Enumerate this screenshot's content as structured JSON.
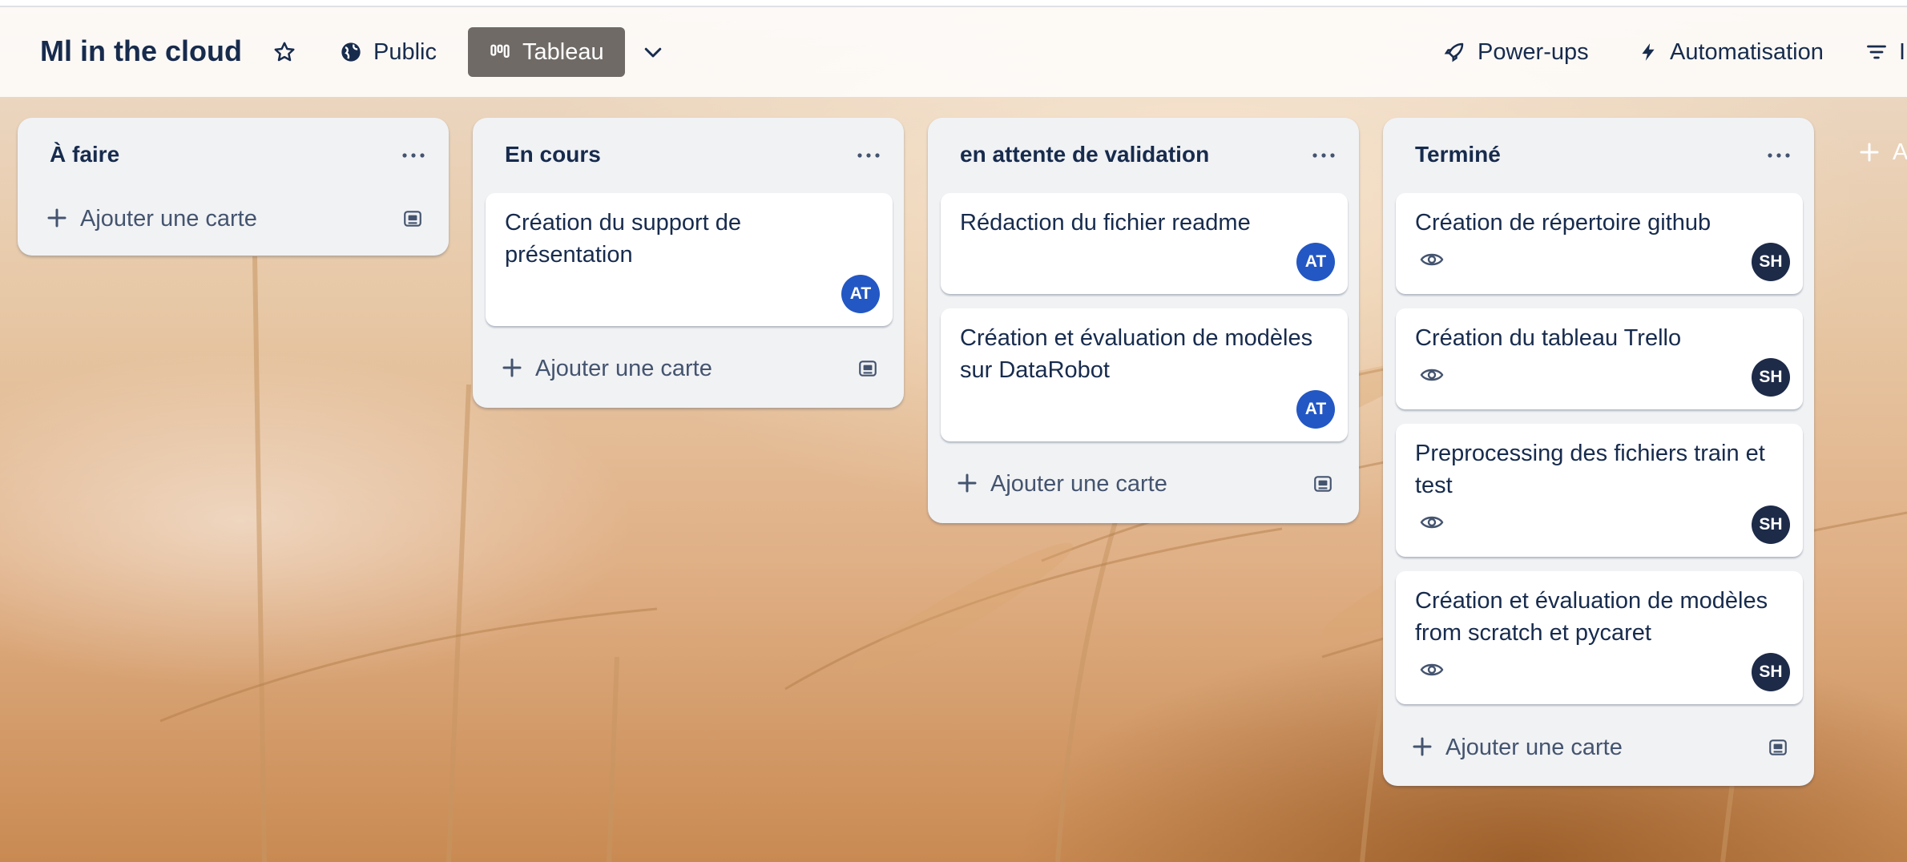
{
  "board": {
    "title": "Ml in the cloud",
    "visibility_label": "Public",
    "view_label": "Tableau",
    "powerups_label": "Power-ups",
    "automation_label": "Automatisation",
    "filter_label_partial": "I"
  },
  "lists": [
    {
      "title": "À faire",
      "cards": [],
      "add_label": "Ajouter une carte"
    },
    {
      "title": "En cours",
      "cards": [
        {
          "title": "Création du support de présentation",
          "member": "AT",
          "watched": false
        }
      ],
      "add_label": "Ajouter une carte"
    },
    {
      "title": "en attente de validation",
      "cards": [
        {
          "title": "Rédaction du fichier readme",
          "member": "AT",
          "watched": false
        },
        {
          "title": "Création et évaluation de modèles sur DataRobot",
          "member": "AT",
          "watched": false
        }
      ],
      "add_label": "Ajouter une carte"
    },
    {
      "title": "Terminé",
      "cards": [
        {
          "title": "Création de répertoire github",
          "member": "SH",
          "watched": true
        },
        {
          "title": "Création du tableau Trello",
          "member": "SH",
          "watched": true
        },
        {
          "title": "Preprocessing des fichiers train et test",
          "member": "SH",
          "watched": true
        },
        {
          "title": "Création et évaluation de modèles from scratch et pycaret",
          "member": "SH",
          "watched": true
        }
      ],
      "add_label": "Ajouter une carte"
    }
  ],
  "add_list_label_partial": "A",
  "icons": {
    "star": "star-icon",
    "visibility": "globe-icon",
    "view": "board-icon",
    "view_switcher": "chevron-down-icon",
    "powerups": "rocket-icon",
    "automation": "bolt-icon",
    "filter": "filter-icon",
    "list_menu": "more-icon",
    "add_card": "plus-icon",
    "template": "card-template-icon",
    "watch": "eye-icon"
  },
  "colors": {
    "member_AT": "#2357c4",
    "member_SH": "#1d2a48",
    "list_bg": "#f1f2f4",
    "view_button_bg": "#6f6a66"
  }
}
